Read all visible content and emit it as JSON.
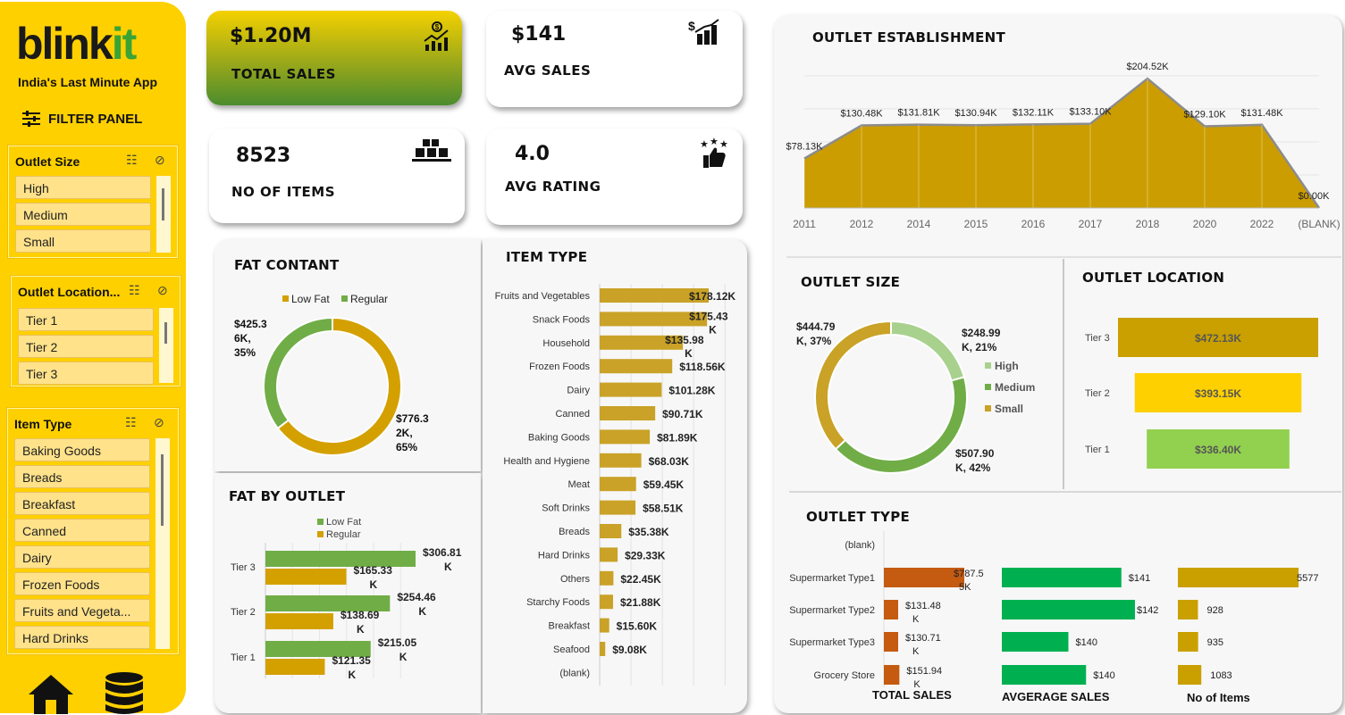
{
  "brand": {
    "logo_main": "blink",
    "logo_accent": "it",
    "tagline": "India's Last Minute App"
  },
  "filter_panel": {
    "label": "FILTER PANEL"
  },
  "slicers": {
    "outlet_size": {
      "title": "Outlet Size",
      "items": [
        "High",
        "Medium",
        "Small"
      ]
    },
    "outlet_location": {
      "title": "Outlet Location...",
      "items": [
        "Tier 1",
        "Tier 2",
        "Tier 3"
      ]
    },
    "item_type": {
      "title": "Item Type",
      "items": [
        "Baking Goods",
        "Breads",
        "Breakfast",
        "Canned",
        "Dairy",
        "Frozen Foods",
        "Fruits and Vegeta...",
        "Hard Drinks"
      ]
    }
  },
  "kpis": {
    "total_sales": {
      "value": "$1.20M",
      "label": "TOTAL SALES",
      "icon": "sales-chart-icon"
    },
    "avg_sales": {
      "value": "$141",
      "label": "AVG SALES",
      "icon": "dollar-bars-icon"
    },
    "no_of_items": {
      "value": "8523",
      "label": "NO OF ITEMS",
      "icon": "boxes-icon"
    },
    "avg_rating": {
      "value": "4.0",
      "label": "AVG RATING",
      "icon": "thumbs-up-stars-icon"
    }
  },
  "colors": {
    "gold": "#d4a000",
    "yellow": "#ffd000",
    "green": "#70ad47",
    "lime": "#92d050",
    "orange": "#c55a11",
    "bright_green": "#00b050",
    "light_green": "#a9d18e",
    "kpi_gold_bar": "#c9a227"
  },
  "chart_data": [
    {
      "id": "fat_content",
      "type": "pie",
      "title": "FAT CONTANT",
      "legend": [
        "Low Fat",
        "Regular"
      ],
      "values": [
        776.32,
        425.36
      ],
      "labels": [
        [
          "$776.3",
          "2K,",
          "65%"
        ],
        [
          "$425.3",
          "6K,",
          "35%"
        ]
      ],
      "colors": [
        "#d4a000",
        "#70ad47"
      ]
    },
    {
      "id": "item_type",
      "type": "bar",
      "title": "ITEM TYPE",
      "categories": [
        "Fruits and Vegetables",
        "Snack Foods",
        "Household",
        "Frozen Foods",
        "Dairy",
        "Canned",
        "Baking Goods",
        "Health and Hygiene",
        "Meat",
        "Soft Drinks",
        "Breads",
        "Hard Drinks",
        "Others",
        "Starchy Foods",
        "Breakfast",
        "Seafood",
        "(blank)"
      ],
      "values": [
        178.12,
        175.43,
        135.98,
        118.56,
        101.28,
        90.71,
        81.89,
        68.03,
        59.45,
        58.51,
        35.38,
        29.33,
        22.45,
        21.88,
        15.6,
        9.08,
        null
      ],
      "labels": [
        [
          "$178.12K"
        ],
        [
          "$175.43",
          "K"
        ],
        [
          "$135.98",
          "K"
        ],
        [
          "$118.56K"
        ],
        [
          "$101.28K"
        ],
        [
          "$90.71K"
        ],
        [
          "$81.89K"
        ],
        [
          "$68.03K"
        ],
        [
          "$59.45K"
        ],
        [
          "$58.51K"
        ],
        [
          "$35.38K"
        ],
        [
          "$29.33K"
        ],
        [
          "$22.45K"
        ],
        [
          "$21.88K"
        ],
        [
          "$15.60K"
        ],
        [
          "$9.08K"
        ],
        []
      ]
    },
    {
      "id": "fat_by_outlet",
      "type": "bar",
      "title": "FAT BY OUTLET",
      "categories": [
        "Tier 3",
        "Tier 2",
        "Tier 1"
      ],
      "legend": [
        "Low Fat",
        "Regular"
      ],
      "series": [
        {
          "name": "Low Fat",
          "values": [
            306.81,
            254.46,
            215.05
          ],
          "labels": [
            [
              "$306.81",
              "K"
            ],
            [
              "$254.46",
              "K"
            ],
            [
              "$215.05",
              "K"
            ]
          ]
        },
        {
          "name": "Regular",
          "values": [
            165.33,
            138.69,
            121.35
          ],
          "labels": [
            [
              "$165.33",
              "K"
            ],
            [
              "$138.69",
              "K"
            ],
            [
              "$121.35",
              "K"
            ]
          ]
        }
      ]
    },
    {
      "id": "outlet_establishment",
      "type": "area",
      "title": "OUTLET ESTABLISHMENT",
      "categories": [
        "2011",
        "2012",
        "2014",
        "2015",
        "2016",
        "2017",
        "2018",
        "2020",
        "2022",
        "(BLANK)"
      ],
      "values": [
        78.13,
        130.48,
        131.81,
        130.94,
        132.11,
        133.1,
        204.52,
        129.1,
        131.48,
        0.0
      ],
      "labels": [
        "$78.13K",
        "$130.48K",
        "$131.81K",
        "$130.94K",
        "$132.11K",
        "$133.10K",
        "$204.52K",
        "$129.10K",
        "$131.48K",
        "$0.00K"
      ]
    },
    {
      "id": "outlet_size",
      "type": "pie",
      "title": "OUTLET SIZE",
      "legend": [
        "High",
        "Medium",
        "Small"
      ],
      "values": [
        248.99,
        507.9,
        444.79
      ],
      "labels": [
        [
          "$248.99",
          "K, 21%"
        ],
        [
          "$507.90",
          "K, 42%"
        ],
        [
          "$444.79",
          "K, 37%"
        ]
      ],
      "colors": [
        "#a9d18e",
        "#70ad47",
        "#c9a227"
      ]
    },
    {
      "id": "outlet_location",
      "type": "bar",
      "title": "OUTLET LOCATION",
      "categories": [
        "Tier 3",
        "Tier 2",
        "Tier 1"
      ],
      "values": [
        472.13,
        393.15,
        336.4
      ],
      "labels": [
        "$472.13K",
        "$393.15K",
        "$336.40K"
      ],
      "colors": [
        "#c9a000",
        "#ffd000",
        "#92d050"
      ]
    },
    {
      "id": "outlet_type",
      "type": "bar",
      "title": "OUTLET TYPE",
      "categories": [
        "(blank)",
        "Supermarket Type1",
        "Supermarket Type2",
        "Supermarket Type3",
        "Grocery Store"
      ],
      "series": [
        {
          "name": "TOTAL SALES",
          "values": [
            null,
            787.55,
            131.48,
            130.71,
            151.94
          ],
          "labels": [
            [],
            [
              "$787.5",
              "5K"
            ],
            [
              "$131.48",
              "K"
            ],
            [
              "$130.71",
              "K"
            ],
            [
              "$151.94",
              "K"
            ]
          ]
        },
        {
          "name": "AVGERAGE  SALES",
          "values": [
            null,
            141,
            142,
            140,
            140
          ],
          "labels": [
            "",
            "$141",
            "$142",
            "$140",
            "$140"
          ]
        },
        {
          "name": "No of Items",
          "values": [
            null,
            5577,
            928,
            935,
            1083
          ],
          "labels": [
            "",
            "5577",
            "928",
            "935",
            "1083"
          ]
        }
      ]
    }
  ]
}
